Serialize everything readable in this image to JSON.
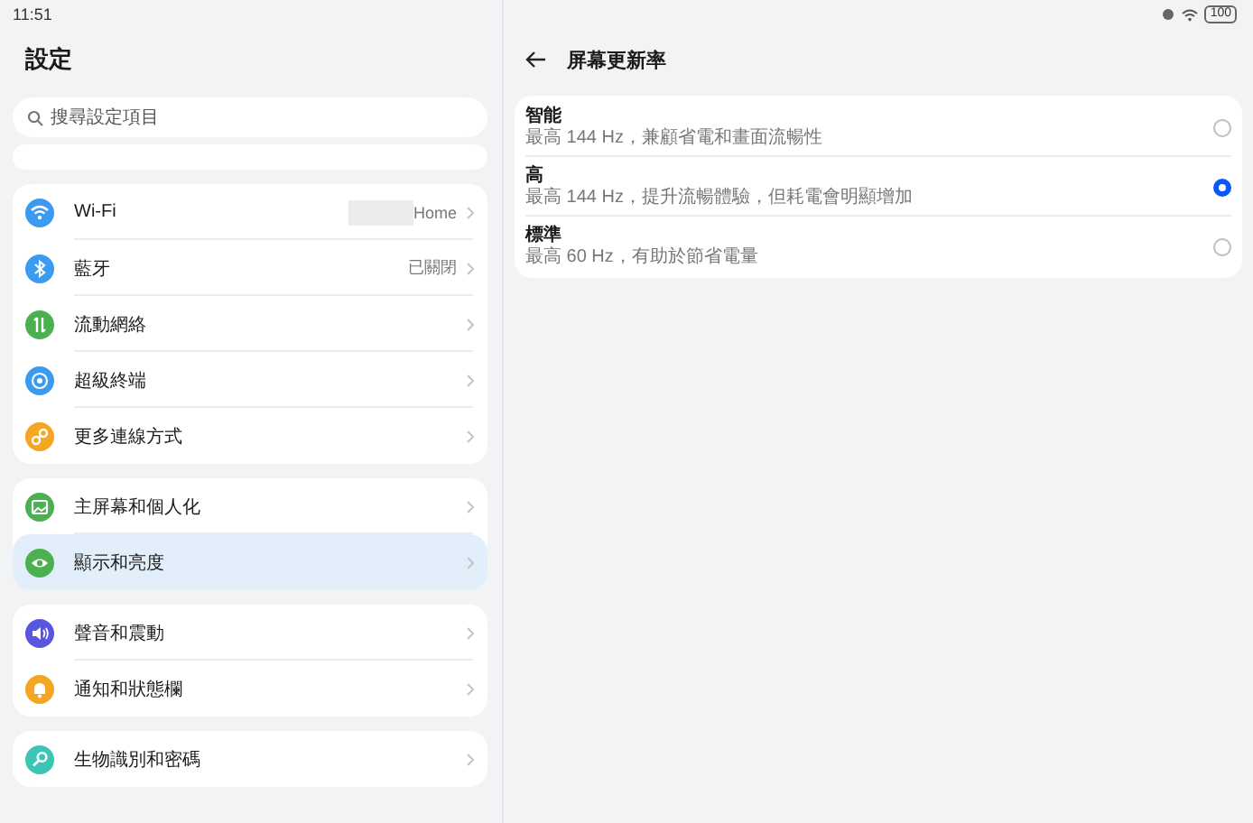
{
  "status_bar": {
    "time": "11:51",
    "battery": "100"
  },
  "sidebar": {
    "title": "設定",
    "search": {
      "placeholder": "搜尋設定項目"
    },
    "groups": [
      {
        "items": [
          {
            "label": "Wi-Fi",
            "value": "Home",
            "redacted": true,
            "color": "#3b9bf0",
            "selected": false
          },
          {
            "label": "藍牙",
            "value": "已關閉",
            "redacted": false,
            "color": "#3b9bf0",
            "selected": false
          },
          {
            "label": "流動網絡",
            "redacted": false,
            "color": "#4cb050",
            "selected": false
          },
          {
            "label": "超級終端",
            "redacted": false,
            "color": "#3b9bf0",
            "selected": false
          },
          {
            "label": "更多連線方式",
            "redacted": false,
            "color": "#f5a623",
            "selected": false
          }
        ]
      },
      {
        "items": [
          {
            "label": "主屏幕和個人化",
            "redacted": false,
            "color": "#4cb050",
            "selected": false
          },
          {
            "label": "顯示和亮度",
            "redacted": false,
            "color": "#4cb050",
            "selected": true
          }
        ]
      },
      {
        "items": [
          {
            "label": "聲音和震動",
            "redacted": false,
            "color": "#5856e0",
            "selected": false
          },
          {
            "label": "通知和狀態欄",
            "redacted": false,
            "color": "#f5a623",
            "selected": false
          }
        ]
      },
      {
        "items": [
          {
            "label": "生物識別和密碼",
            "redacted": false,
            "color": "#3cc4b4",
            "selected": false
          }
        ]
      }
    ]
  },
  "detail": {
    "title": "屏幕更新率",
    "options": [
      {
        "label": "智能",
        "description": "最高 144 Hz，兼顧省電和畫面流暢性",
        "selected": false
      },
      {
        "label": "高",
        "description": "最高 144 Hz，提升流暢體驗，但耗電會明顯增加",
        "selected": true
      },
      {
        "label": "標準",
        "description": "最高 60 Hz，有助於節省電量",
        "selected": false
      }
    ]
  }
}
